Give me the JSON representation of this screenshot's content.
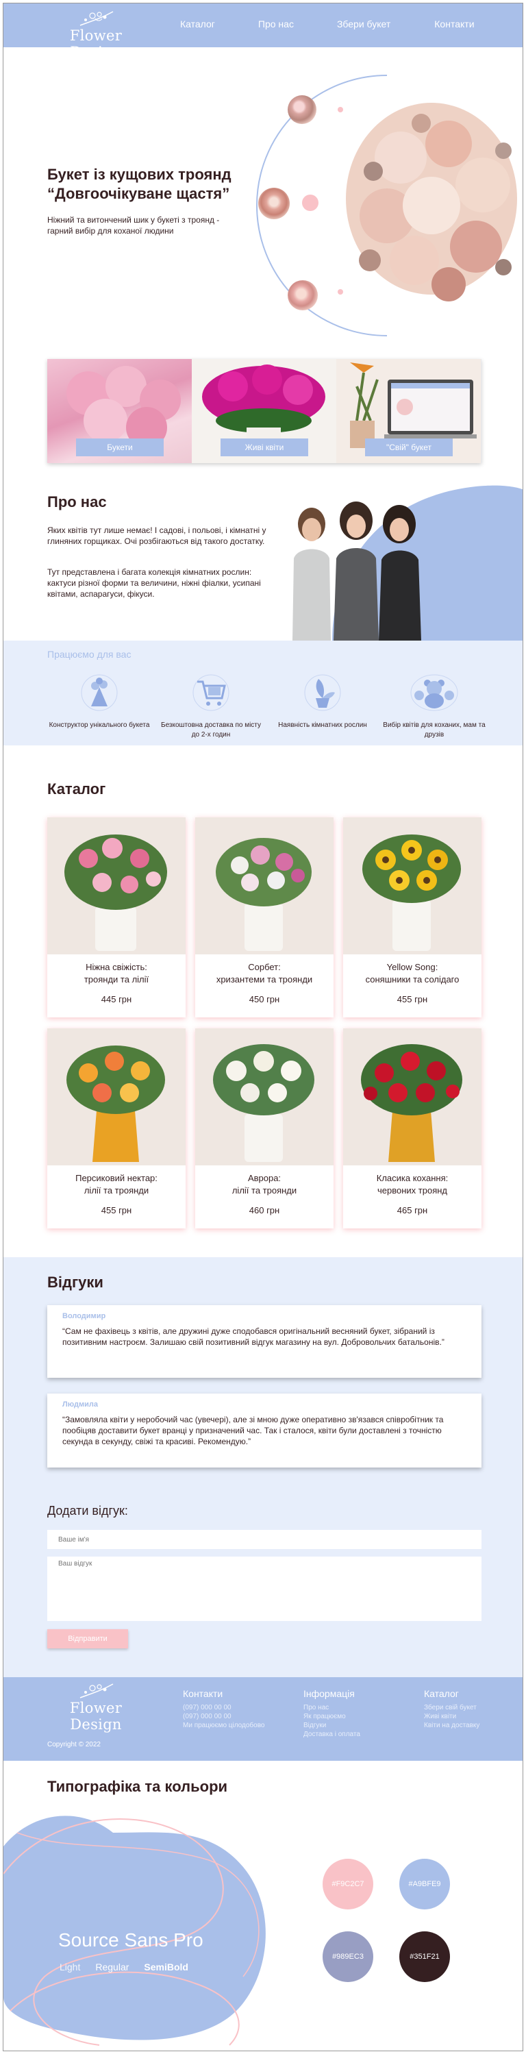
{
  "header": {
    "logo_text": "Flower Design",
    "nav": [
      "Каталог",
      "Про нас",
      "Збери букет",
      "Контакти"
    ]
  },
  "hero": {
    "title": "Букет із кущових троянд “Довгоочікуване щастя”",
    "text": "Ніжний та витончений шик у букеті з троянд - гарний вибір для коханої людини"
  },
  "categories": [
    "Букети",
    "Живі квіти",
    "\"Свій\" букет"
  ],
  "about": {
    "title": "Про нас",
    "p1": "Яких квітів тут лише немає! І садові, і польові, і кімнатні у глиняних горщиках. Очі розбігаються від такого достатку.",
    "p2": "Тут представлена і багата колекція кімнатних рослин: кактуси різної форми та величини, ніжні фіалки, усипані квітами, аспарагуси, фікуси."
  },
  "work": {
    "title": "Працюємо для вас",
    "items": [
      {
        "icon": "bouquet-icon",
        "label": "Конструктор унікального букета"
      },
      {
        "icon": "cart-icon",
        "label": "Безкоштовна доставка по місту до 2-х годин"
      },
      {
        "icon": "plant-pot-icon",
        "label": "Наявність кімнатних рослин"
      },
      {
        "icon": "teddy-bear-icon",
        "label": "Вибір квітів для коханих, мам та друзів"
      }
    ]
  },
  "catalog": {
    "title": "Каталог",
    "items": [
      {
        "name": "Ніжна свіжість:\nтроянди та лілії",
        "price": "445 грн"
      },
      {
        "name": "Сорбет:\nхризантеми та троянди",
        "price": "450 грн"
      },
      {
        "name": "Yellow Song:\nсоняшники та солідаго",
        "price": "455 грн"
      },
      {
        "name": "Персиковий нектар:\nлілії та троянди",
        "price": "455 грн"
      },
      {
        "name": "Аврора:\nлілії та троянди",
        "price": "460 грн"
      },
      {
        "name": "Класика кохання:\nчервоних троянд",
        "price": "465 грн"
      }
    ]
  },
  "reviews": {
    "title": "Відгуки",
    "items": [
      {
        "author": "Володимир",
        "text": "“Сам не фахівець з квітів, але дружині дуже сподобався оригінальний весняний букет, зібраний із позитивним настроєм. Залишаю свій позитивний відгук магазину на вул. Добровольчих батальонів.”"
      },
      {
        "author": "Людмила",
        "text": "“Замовляла квіти у неробочий час (увечері), але зі мною дуже оперативно зв'язався співробітник та пообіцяв доставити букет вранці у призначений час. Так і сталося, квіти були доставлені з точністю секунда в секунду, свіжі та красиві. Рекомендую.”"
      }
    ],
    "add_title": "Додати відгук:",
    "name_placeholder": "Ваше ім'я",
    "review_placeholder": "Ваш відгук",
    "send_label": "Відправити"
  },
  "footer": {
    "logo_text": "Flower Design",
    "contacts_title": "Контакти",
    "contacts": [
      "(097) 000 00 00",
      "(097) 000 00 00",
      "Ми працюємо цілодобово"
    ],
    "info_title": "Інформація",
    "info": [
      "Про нас",
      "Як працюємо",
      "Відгуки",
      "Доставка і оплата"
    ],
    "catalog_title": "Каталог",
    "catalog": [
      "Збери свій букет",
      "Живі квіти",
      "Квіти на доставку"
    ],
    "copyright": "Copyright © 2022"
  },
  "typography": {
    "title": "Типографіка та кольори",
    "font": "Source Sans Pro",
    "weights": [
      "Light",
      "Regular",
      "SemiBold"
    ],
    "colors": [
      "#F9C2C7",
      "#A9BFE9",
      "#989EC3",
      "#351F21"
    ]
  }
}
